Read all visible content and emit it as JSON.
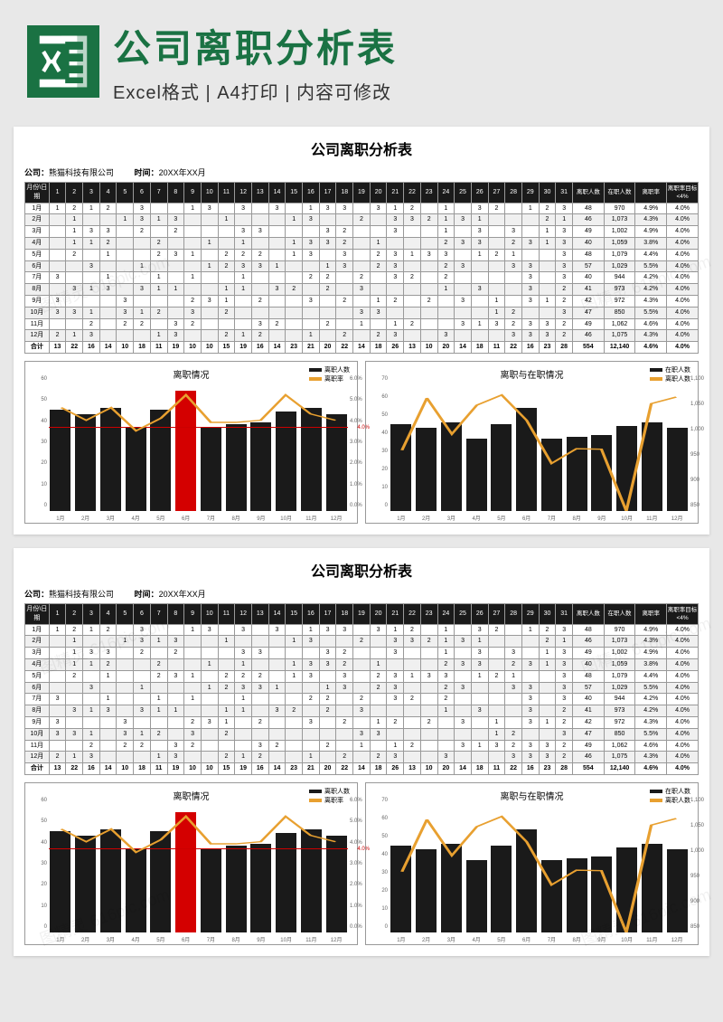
{
  "header": {
    "title": "公司离职分析表",
    "subtitle": "Excel格式 | A4打印 | 内容可修改",
    "icon_name": "excel-icon"
  },
  "sheet": {
    "title": "公司离职分析表",
    "company_label": "公司：",
    "company_value": "熊猫科技有限公司",
    "time_label": "时间：",
    "time_value": "20XX年XX月",
    "col_month": "月份\\日期",
    "days": [
      "1",
      "2",
      "3",
      "4",
      "5",
      "6",
      "7",
      "8",
      "9",
      "10",
      "11",
      "12",
      "13",
      "14",
      "15",
      "16",
      "17",
      "18",
      "19",
      "20",
      "21",
      "22",
      "23",
      "24",
      "25",
      "26",
      "27",
      "28",
      "29",
      "30",
      "31"
    ],
    "stat_headers": [
      "离职人数",
      "在职人数",
      "离职率",
      "离职率目标<4%"
    ],
    "rows": [
      {
        "m": "1月",
        "d": [
          "1",
          "2",
          "1",
          "2",
          "",
          "3",
          "",
          "",
          "1",
          "3",
          "",
          "3",
          "",
          "3",
          "",
          "1",
          "3",
          "3",
          "",
          "3",
          "1",
          "2",
          "",
          "1",
          "",
          "3",
          "2",
          "",
          "1",
          "2",
          "3"
        ],
        "s": [
          "48",
          "970",
          "4.9%",
          "4.0%"
        ]
      },
      {
        "m": "2月",
        "d": [
          "",
          "1",
          "",
          "",
          "1",
          "3",
          "1",
          "3",
          "",
          "",
          "1",
          "",
          "",
          "",
          "1",
          "3",
          "",
          "",
          "2",
          "",
          "3",
          "3",
          "2",
          "1",
          "3",
          "1",
          "",
          "",
          "",
          "2",
          "1"
        ],
        "s": [
          "46",
          "1,073",
          "4.3%",
          "4.0%"
        ]
      },
      {
        "m": "3月",
        "d": [
          "",
          "1",
          "3",
          "3",
          "",
          "2",
          "",
          "2",
          "",
          "",
          "",
          "3",
          "3",
          "",
          "",
          "",
          "3",
          "2",
          "",
          "",
          "3",
          "",
          "",
          "1",
          "",
          "3",
          "",
          "3",
          "",
          "1",
          "3"
        ],
        "s": [
          "49",
          "1,002",
          "4.9%",
          "4.0%"
        ]
      },
      {
        "m": "4月",
        "d": [
          "",
          "1",
          "1",
          "2",
          "",
          "",
          "2",
          "",
          "",
          "1",
          "",
          "1",
          "",
          "",
          "1",
          "3",
          "3",
          "2",
          "",
          "1",
          "",
          "",
          "",
          "2",
          "3",
          "3",
          "",
          "2",
          "3",
          "1",
          "3"
        ],
        "s": [
          "40",
          "1,059",
          "3.8%",
          "4.0%"
        ]
      },
      {
        "m": "5月",
        "d": [
          "",
          "2",
          "",
          "1",
          "",
          "",
          "2",
          "3",
          "1",
          "",
          "2",
          "2",
          "2",
          "",
          "1",
          "3",
          "",
          "3",
          "",
          "2",
          "3",
          "1",
          "3",
          "3",
          "",
          "1",
          "2",
          "1",
          "",
          "",
          "3"
        ],
        "s": [
          "48",
          "1,079",
          "4.4%",
          "4.0%"
        ]
      },
      {
        "m": "6月",
        "d": [
          "",
          "",
          "3",
          "",
          "",
          "1",
          "",
          "",
          "",
          "1",
          "2",
          "3",
          "3",
          "1",
          "",
          "",
          "1",
          "3",
          "",
          "2",
          "3",
          "",
          "",
          "2",
          "3",
          "",
          "",
          "3",
          "3",
          "",
          "3"
        ],
        "s": [
          "57",
          "1,029",
          "5.5%",
          "4.0%"
        ]
      },
      {
        "m": "7月",
        "d": [
          "3",
          "",
          "",
          "1",
          "",
          "",
          "1",
          "",
          "1",
          "",
          "",
          "1",
          "",
          "",
          "",
          "2",
          "2",
          "",
          "2",
          "",
          "3",
          "2",
          "",
          "2",
          "",
          "",
          "",
          "",
          "3",
          "",
          "3"
        ],
        "s": [
          "40",
          "944",
          "4.2%",
          "4.0%"
        ]
      },
      {
        "m": "8月",
        "d": [
          "",
          "3",
          "1",
          "3",
          "",
          "3",
          "1",
          "1",
          "",
          "",
          "1",
          "1",
          "",
          "3",
          "2",
          "",
          "2",
          "",
          "3",
          "",
          "",
          "",
          "",
          "1",
          "",
          "3",
          "",
          "",
          "3",
          "",
          "2"
        ],
        "s": [
          "41",
          "973",
          "4.2%",
          "4.0%"
        ]
      },
      {
        "m": "9月",
        "d": [
          "3",
          "",
          "",
          "",
          "3",
          "",
          "",
          "",
          "2",
          "3",
          "1",
          "",
          "2",
          "",
          "",
          "3",
          "",
          "2",
          "",
          "1",
          "2",
          "",
          "2",
          "",
          "3",
          "",
          "1",
          "",
          "3",
          "1",
          "2"
        ],
        "s": [
          "42",
          "972",
          "4.3%",
          "4.0%"
        ]
      },
      {
        "m": "10月",
        "d": [
          "3",
          "3",
          "1",
          "",
          "3",
          "1",
          "2",
          "",
          "3",
          "",
          "2",
          "",
          "",
          "",
          "",
          "",
          "",
          "",
          "3",
          "3",
          "",
          "",
          "",
          "",
          "",
          "",
          "1",
          "2",
          "",
          "",
          "3"
        ],
        "s": [
          "47",
          "850",
          "5.5%",
          "4.0%"
        ]
      },
      {
        "m": "11月",
        "d": [
          "",
          "",
          "2",
          "",
          "2",
          "2",
          "",
          "3",
          "2",
          "",
          "",
          "",
          "3",
          "2",
          "",
          "",
          "2",
          "",
          "1",
          "",
          "1",
          "2",
          "",
          "",
          "3",
          "1",
          "3",
          "2",
          "3",
          "3",
          "2"
        ],
        "s": [
          "49",
          "1,062",
          "4.6%",
          "4.0%"
        ]
      },
      {
        "m": "12月",
        "d": [
          "2",
          "1",
          "3",
          "",
          "",
          "",
          "1",
          "3",
          "",
          "",
          "2",
          "1",
          "2",
          "",
          "",
          "1",
          "",
          "2",
          "",
          "2",
          "3",
          "",
          "",
          "3",
          "",
          "",
          "",
          "3",
          "3",
          "3",
          "2"
        ],
        "s": [
          "46",
          "1,075",
          "4.3%",
          "4.0%"
        ]
      }
    ],
    "total_label": "合计",
    "total_days": [
      "13",
      "22",
      "16",
      "14",
      "10",
      "18",
      "11",
      "19",
      "10",
      "10",
      "15",
      "19",
      "16",
      "14",
      "23",
      "21",
      "20",
      "22",
      "14",
      "18",
      "26",
      "13",
      "10",
      "20",
      "14",
      "18",
      "11",
      "22",
      "16",
      "23",
      "28"
    ],
    "total_stats": [
      "554",
      "12,140",
      "4.6%",
      "4.0%"
    ]
  },
  "chart_data": [
    {
      "type": "bar+line",
      "title": "离职情况",
      "legend": [
        "离职人数",
        "离职率"
      ],
      "target_label": "4.0%",
      "categories": [
        "1月",
        "2月",
        "3月",
        "4月",
        "5月",
        "6月",
        "7月",
        "8月",
        "9月",
        "10月",
        "11月",
        "12月"
      ],
      "bars": [
        48,
        46,
        49,
        40,
        48,
        57,
        40,
        41,
        42,
        47,
        49,
        46
      ],
      "highlight_index": 5,
      "line_pct": [
        4.9,
        4.3,
        4.9,
        3.8,
        4.4,
        5.5,
        4.2,
        4.2,
        4.3,
        5.5,
        4.6,
        4.3
      ],
      "ylim": [
        0,
        60
      ],
      "y2lim": [
        0,
        6
      ],
      "yticks": [
        0,
        10,
        20,
        30,
        40,
        50,
        60
      ],
      "y2ticks": [
        "0.0%",
        "1.0%",
        "2.0%",
        "3.0%",
        "4.0%",
        "5.0%",
        "6.0%"
      ],
      "target_pct": 4.0
    },
    {
      "type": "bar+line",
      "title": "离职与在职情况",
      "legend": [
        "在职人数",
        "离职人数"
      ],
      "categories": [
        "1月",
        "2月",
        "3月",
        "4月",
        "5月",
        "6月",
        "7月",
        "8月",
        "9月",
        "10月",
        "11月",
        "12月"
      ],
      "bars": [
        48,
        46,
        49,
        40,
        48,
        57,
        40,
        41,
        42,
        47,
        49,
        46
      ],
      "line_vals": [
        970,
        1073,
        1002,
        1059,
        1079,
        1029,
        944,
        973,
        972,
        850,
        1062,
        1075
      ],
      "ylim": [
        0,
        70
      ],
      "y2lim": [
        850,
        1100
      ],
      "yticks": [
        0,
        10,
        20,
        30,
        40,
        50,
        60,
        70
      ],
      "y2ticks": [
        "850",
        "900",
        "950",
        "1,000",
        "1,050",
        "1,100"
      ]
    }
  ],
  "watermark": "图精灵 616pic.com"
}
